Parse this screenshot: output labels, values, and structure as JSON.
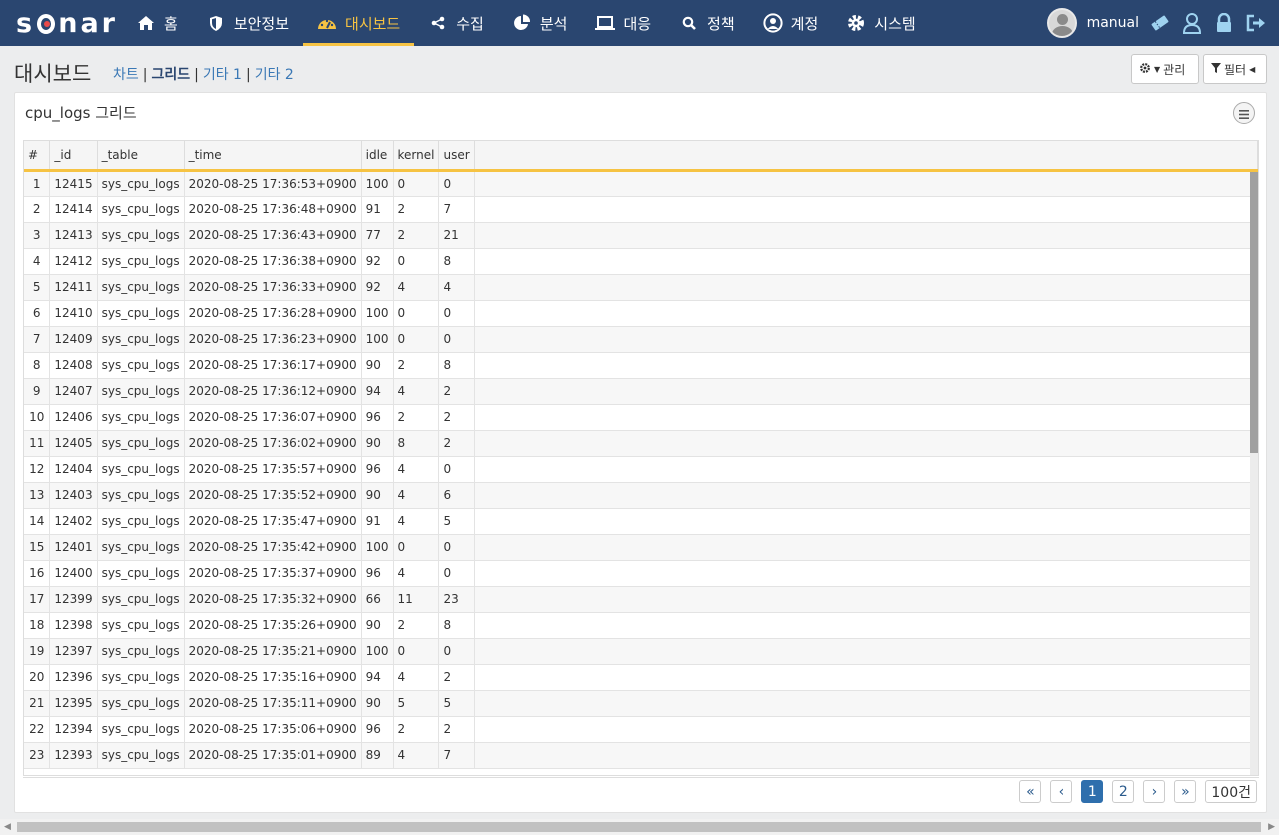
{
  "brand": {
    "pre": "s",
    "post": "nar"
  },
  "nav": [
    {
      "label": "홈",
      "icon": "home-icon"
    },
    {
      "label": "보안정보",
      "icon": "shield-icon"
    },
    {
      "label": "대시보드",
      "icon": "dashboard-gauge-icon",
      "active": true
    },
    {
      "label": "수집",
      "icon": "share-icon"
    },
    {
      "label": "분석",
      "icon": "pie-chart-icon"
    },
    {
      "label": "대응",
      "icon": "laptop-icon"
    },
    {
      "label": "정책",
      "icon": "search-icon"
    },
    {
      "label": "계정",
      "icon": "user-circle-icon"
    },
    {
      "label": "시스템",
      "icon": "gear-icon"
    }
  ],
  "user": {
    "name": "manual"
  },
  "page": {
    "title": "대시보드"
  },
  "subnav": [
    "차트",
    "그리드",
    "기타 1",
    "기타 2"
  ],
  "header_buttons": {
    "manage": "관리",
    "filter": "필터"
  },
  "panel": {
    "title": "cpu_logs 그리드"
  },
  "grid": {
    "columns": [
      "#",
      "_id",
      "_table",
      "_time",
      "idle",
      "kernel",
      "user"
    ],
    "rows": [
      [
        "1",
        "12415",
        "sys_cpu_logs",
        "2020-08-25 17:36:53+0900",
        "100",
        "0",
        "0"
      ],
      [
        "2",
        "12414",
        "sys_cpu_logs",
        "2020-08-25 17:36:48+0900",
        "91",
        "2",
        "7"
      ],
      [
        "3",
        "12413",
        "sys_cpu_logs",
        "2020-08-25 17:36:43+0900",
        "77",
        "2",
        "21"
      ],
      [
        "4",
        "12412",
        "sys_cpu_logs",
        "2020-08-25 17:36:38+0900",
        "92",
        "0",
        "8"
      ],
      [
        "5",
        "12411",
        "sys_cpu_logs",
        "2020-08-25 17:36:33+0900",
        "92",
        "4",
        "4"
      ],
      [
        "6",
        "12410",
        "sys_cpu_logs",
        "2020-08-25 17:36:28+0900",
        "100",
        "0",
        "0"
      ],
      [
        "7",
        "12409",
        "sys_cpu_logs",
        "2020-08-25 17:36:23+0900",
        "100",
        "0",
        "0"
      ],
      [
        "8",
        "12408",
        "sys_cpu_logs",
        "2020-08-25 17:36:17+0900",
        "90",
        "2",
        "8"
      ],
      [
        "9",
        "12407",
        "sys_cpu_logs",
        "2020-08-25 17:36:12+0900",
        "94",
        "4",
        "2"
      ],
      [
        "10",
        "12406",
        "sys_cpu_logs",
        "2020-08-25 17:36:07+0900",
        "96",
        "2",
        "2"
      ],
      [
        "11",
        "12405",
        "sys_cpu_logs",
        "2020-08-25 17:36:02+0900",
        "90",
        "8",
        "2"
      ],
      [
        "12",
        "12404",
        "sys_cpu_logs",
        "2020-08-25 17:35:57+0900",
        "96",
        "4",
        "0"
      ],
      [
        "13",
        "12403",
        "sys_cpu_logs",
        "2020-08-25 17:35:52+0900",
        "90",
        "4",
        "6"
      ],
      [
        "14",
        "12402",
        "sys_cpu_logs",
        "2020-08-25 17:35:47+0900",
        "91",
        "4",
        "5"
      ],
      [
        "15",
        "12401",
        "sys_cpu_logs",
        "2020-08-25 17:35:42+0900",
        "100",
        "0",
        "0"
      ],
      [
        "16",
        "12400",
        "sys_cpu_logs",
        "2020-08-25 17:35:37+0900",
        "96",
        "4",
        "0"
      ],
      [
        "17",
        "12399",
        "sys_cpu_logs",
        "2020-08-25 17:35:32+0900",
        "66",
        "11",
        "23"
      ],
      [
        "18",
        "12398",
        "sys_cpu_logs",
        "2020-08-25 17:35:26+0900",
        "90",
        "2",
        "8"
      ],
      [
        "19",
        "12397",
        "sys_cpu_logs",
        "2020-08-25 17:35:21+0900",
        "100",
        "0",
        "0"
      ],
      [
        "20",
        "12396",
        "sys_cpu_logs",
        "2020-08-25 17:35:16+0900",
        "94",
        "4",
        "2"
      ],
      [
        "21",
        "12395",
        "sys_cpu_logs",
        "2020-08-25 17:35:11+0900",
        "90",
        "5",
        "5"
      ],
      [
        "22",
        "12394",
        "sys_cpu_logs",
        "2020-08-25 17:35:06+0900",
        "96",
        "2",
        "2"
      ],
      [
        "23",
        "12393",
        "sys_cpu_logs",
        "2020-08-25 17:35:01+0900",
        "89",
        "4",
        "7"
      ]
    ]
  },
  "pager": {
    "first": "«",
    "prev": "‹",
    "pages": [
      "1",
      "2"
    ],
    "current": "1",
    "next": "›",
    "last": "»",
    "page_size": "100건"
  },
  "colors": {
    "nav_bg": "#2a4670",
    "accent": "#f6c343",
    "link": "#3a78b5",
    "page_active": "#2f6fad"
  }
}
